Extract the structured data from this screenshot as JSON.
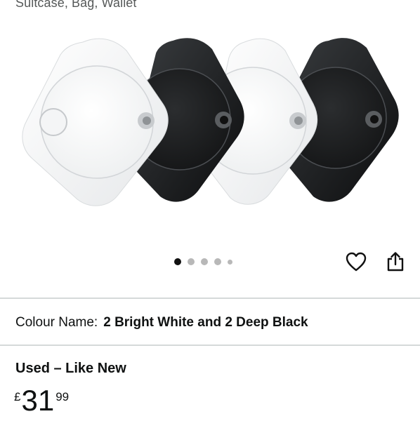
{
  "product": {
    "subtitle": "Suitcase, Bag, Wallet"
  },
  "gallery": {
    "image_name": "product-image",
    "dot_count": 5,
    "active_index": 0
  },
  "actions": {
    "favorite_icon": "heart-icon",
    "share_icon": "share-icon"
  },
  "variant": {
    "label": "Colour Name:",
    "value": "2 Bright White and 2 Deep Black"
  },
  "offer": {
    "condition": "Used – Like New",
    "price": {
      "symbol": "£",
      "whole": "31",
      "fraction": "99"
    }
  }
}
